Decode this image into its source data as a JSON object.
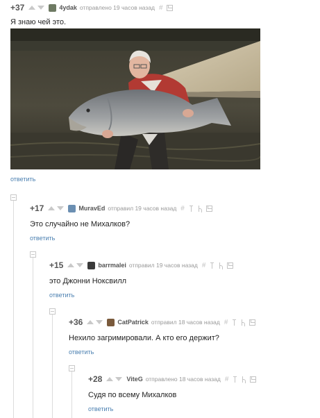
{
  "comments": [
    {
      "rating": "+37",
      "user": "4ydak",
      "meta": "отправлено 19 часов назад",
      "text": "Я знаю чей это.",
      "reply": "ответить"
    },
    {
      "rating": "+17",
      "user": "MuravEd",
      "meta": "отправил 19 часов назад",
      "text": "Это случайно не Михалков?",
      "reply": "ответить"
    },
    {
      "rating": "+15",
      "user": "barrmalei",
      "meta": "отправил 19 часов назад",
      "text": "это Джонни Ноксвилл",
      "reply": "ответить"
    },
    {
      "rating": "+36",
      "user": "CatPatrick",
      "meta": "отправил 18 часов назад",
      "text": "Нехило загримировали. А кто его держит?",
      "reply": "ответить"
    },
    {
      "rating": "+28",
      "user": "ViteG",
      "meta": "отправлено 18 часов назад",
      "text": "Судя по всему Михалков",
      "reply": "ответить"
    }
  ],
  "icons": {
    "upvote": "upvote-icon",
    "downvote": "downvote-icon",
    "hash": "#",
    "parent": "parent-comment-icon",
    "link": "link-icon",
    "save": "save-icon"
  },
  "colors": {
    "link": "#4a7fb0",
    "muted": "#999999"
  }
}
